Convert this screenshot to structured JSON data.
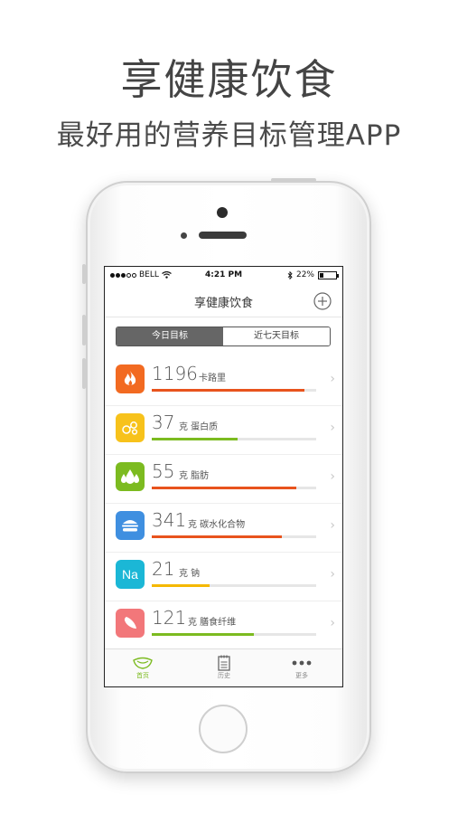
{
  "promo": {
    "title": "享健康饮食",
    "subtitle": "最好用的营养目标管理APP"
  },
  "status_bar": {
    "carrier": "BELL",
    "time": "4:21 PM",
    "battery": "22%",
    "battery_level": 0.22
  },
  "nav": {
    "title": "享健康饮食",
    "add_icon": "plus-circle-icon"
  },
  "segments": [
    {
      "label": "今日目标",
      "active": true
    },
    {
      "label": "近七天目标",
      "active": false
    }
  ],
  "nutrients": [
    {
      "value": "1196",
      "unit": "卡路里",
      "icon": "flame-icon",
      "color": "#f26a21",
      "bar_color": "#e8531d",
      "progress": 0.93
    },
    {
      "value": "37",
      "unit": "克 蛋白质",
      "icon": "egg-molecule-icon",
      "color": "#f7c21b",
      "bar_color": "#7cbb20",
      "progress": 0.52
    },
    {
      "value": "55",
      "unit": "克 脂肪",
      "icon": "drops-icon",
      "color": "#7cbb20",
      "bar_color": "#e8531d",
      "progress": 0.88
    },
    {
      "value": "341",
      "unit": "克 碳水化合物",
      "icon": "burger-icon",
      "color": "#3f8fe0",
      "bar_color": "#e8531d",
      "progress": 0.79
    },
    {
      "value": "21",
      "unit": "克 钠",
      "icon": "sodium-icon",
      "icon_text": "Na",
      "color": "#1bb7d6",
      "bar_color": "#f5b800",
      "progress": 0.35
    },
    {
      "value": "121",
      "unit": "克 膳食纤维",
      "icon": "fiber-icon",
      "color": "#f2777a",
      "bar_color": "#7cbb20",
      "progress": 0.62
    }
  ],
  "tabs": [
    {
      "label": "首页",
      "icon": "bowl-icon",
      "active": true
    },
    {
      "label": "历史",
      "icon": "notebook-icon",
      "active": false
    },
    {
      "label": "更多",
      "icon": "more-dots-icon",
      "active": false
    }
  ]
}
